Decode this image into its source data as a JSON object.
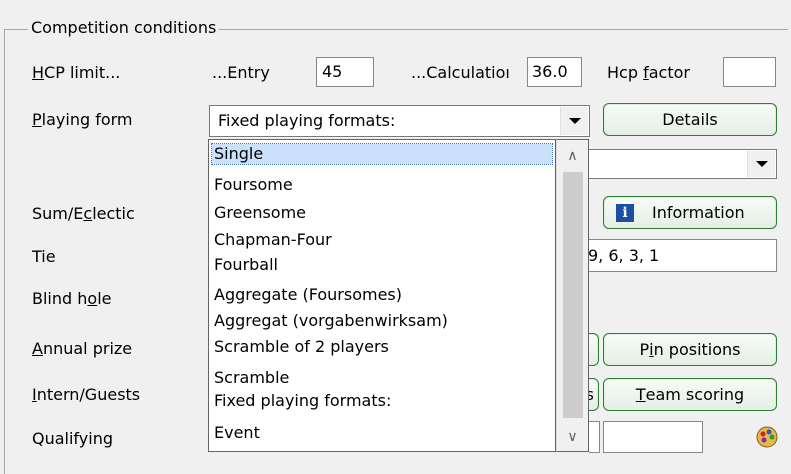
{
  "group": {
    "title": "Competition conditions"
  },
  "hcp": {
    "label_pre": "",
    "label_u": "H",
    "label_post": "CP limit...",
    "entry_label": "...Entry",
    "entry_value": "45",
    "calc_label": "...Calculatioı",
    "calc_value": "36.0",
    "factor_label_pre": "Hcp ",
    "factor_label_u": "f",
    "factor_label_post": "actor",
    "factor_value": ""
  },
  "playing_form": {
    "label_u": "P",
    "label_post": "laying form",
    "selected": "Fixed playing formats:",
    "details_button": "Details"
  },
  "labels": {
    "sum_pre": "Sum/E",
    "sum_u": "c",
    "sum_post": "lectic",
    "tie": "Tie",
    "blind_pre": "Blind h",
    "blind_u": "o",
    "blind_post": "le",
    "annual_u": "A",
    "annual_post": "nnual prize",
    "intern_u": "I",
    "intern_post": "ntern/Guests",
    "qualifying": "Qualifying"
  },
  "buttons": {
    "information": "Information",
    "pin_pre": "P",
    "pin_u": "i",
    "pin_post": "n positions",
    "team_u": "T",
    "team_post": "eam scoring",
    "partial_s": "s"
  },
  "tie_value": "9, 6, 3, 1",
  "dropdown_list": {
    "items": [
      "Single",
      "Foursome",
      "Greensome",
      "Chapman-Four",
      "Fourball",
      "Aggregate (Foursomes)",
      "Aggregat (vorgabenwirksam)",
      "Scramble of 2 players",
      "Scramble",
      "Fixed playing formats:",
      "Event"
    ],
    "selected_index": 0
  },
  "colors": {
    "accent_border": "#2e7d32",
    "selection": "#cbe1fb",
    "info_icon": "#1a4fa3"
  }
}
